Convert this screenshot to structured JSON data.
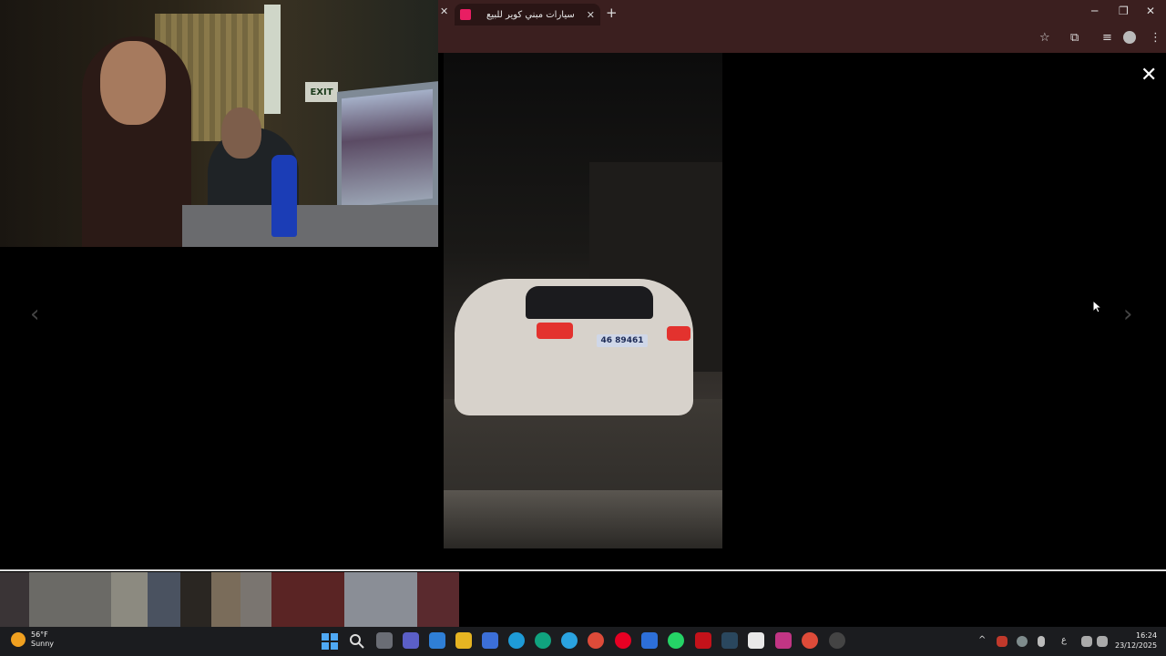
{
  "browser": {
    "tab_title": "سيارات مبني كوير للبيع",
    "tab_close": "✕",
    "closed_tab_x": "✕",
    "new_tab": "+",
    "window_controls": {
      "minimize": "─",
      "restore": "❐",
      "close": "✕"
    },
    "toolbar_icons": {
      "bookmark": "☆",
      "extensions": "⧉",
      "media": "≡",
      "menu": "⋮"
    }
  },
  "webcam": {
    "exit_sign": "EXIT"
  },
  "viewer": {
    "close": "✕",
    "prev": "‹",
    "next": "›",
    "plate_text": "46 89461"
  },
  "filmstrip": {
    "thumbnails": [
      {
        "name": "thumb-1",
        "color": "#3a3436"
      },
      {
        "name": "thumb-2",
        "color": "#6b6a66"
      },
      {
        "name": "thumb-3",
        "color": "#8c8a80"
      },
      {
        "name": "thumb-4",
        "color": "#4a5260"
      },
      {
        "name": "thumb-5",
        "color": "#2a2622"
      },
      {
        "name": "thumb-6",
        "color": "#7a6c5a"
      },
      {
        "name": "thumb-7",
        "color": "#7a7570"
      },
      {
        "name": "thumb-8",
        "color": "#5a2424"
      },
      {
        "name": "thumb-9",
        "color": "#8a8e96"
      },
      {
        "name": "thumb-10",
        "color": "#5a2a2e"
      }
    ]
  },
  "taskbar": {
    "weather_temp": "56°F",
    "weather_desc": "Sunny",
    "time": "16:24",
    "date": "23/12/2025",
    "tray_chevron": "^",
    "tray_lang": "ع"
  },
  "colors": {
    "chrome_bg": "#3b1f1f",
    "taskbar_bg": "#1b1c1f"
  }
}
